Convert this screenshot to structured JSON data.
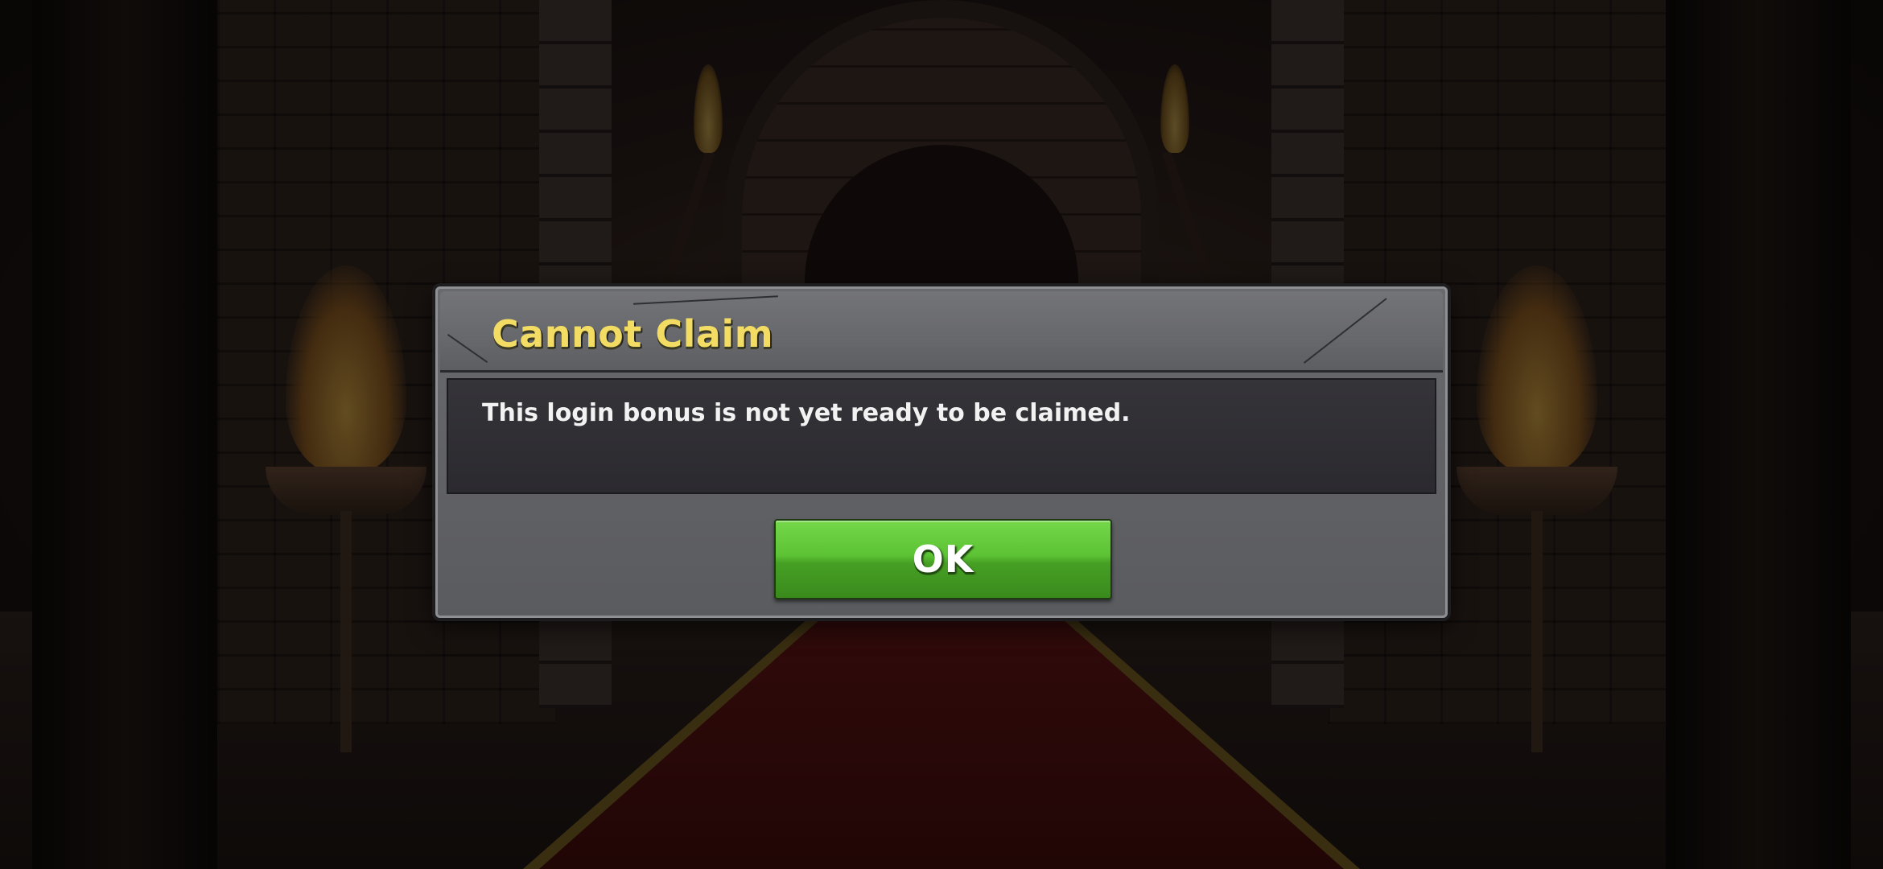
{
  "dialog": {
    "title": "Cannot Claim",
    "message": "This login bonus is not yet ready to be claimed.",
    "ok_label": "OK"
  },
  "colors": {
    "title_text": "#f3dc63",
    "ok_button": "#5cc334",
    "dialog_frame": "#5a5b5f",
    "message_panel": "#2e2d32"
  },
  "background": {
    "scene": "dungeon-throne-hall"
  }
}
